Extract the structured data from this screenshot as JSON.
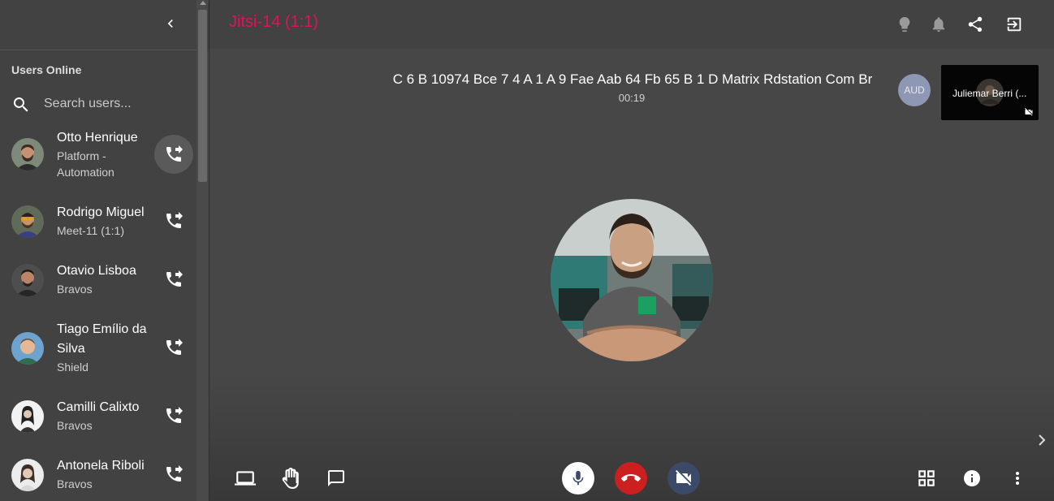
{
  "sidebar": {
    "section_title": "Users Online",
    "search": {
      "placeholder": "Search users..."
    },
    "users": [
      {
        "name": "Otto Henrique",
        "subtitle": "Platform - Automation"
      },
      {
        "name": "Rodrigo Miguel",
        "subtitle": "Meet-11 (1:1)"
      },
      {
        "name": "Otavio Lisboa",
        "subtitle": "Bravos"
      },
      {
        "name": "Tiago Emílio da Silva",
        "subtitle": "Shield"
      },
      {
        "name": "Camilli Calixto",
        "subtitle": "Bravos"
      },
      {
        "name": "Antonela Riboli",
        "subtitle": "Bravos"
      }
    ]
  },
  "header": {
    "room_title": "Jitsi-14 (1:1)",
    "title_color": "#e0135a",
    "icons": [
      "lightbulb-icon",
      "bell-icon",
      "share-icon",
      "exit-icon"
    ]
  },
  "meeting": {
    "name": "C 6 B 10974 Bce 7 4 A 1 A 9 Fae Aab 64 Fb 65 B 1 D Matrix Rdstation Com Br",
    "timer": "00:19",
    "audio_badge": "AUD",
    "thumbnail_name": "Juliemar Berri (..."
  },
  "toolbar": {
    "left": [
      "screen-share-icon",
      "raise-hand-icon",
      "chat-icon"
    ],
    "center": [
      "microphone-icon",
      "hangup-icon",
      "camera-off-icon"
    ],
    "right": [
      "grid-view-icon",
      "info-icon",
      "more-vertical-icon"
    ],
    "hangup_color": "#cc1f1f",
    "camera_off_color": "#3b4a68"
  }
}
